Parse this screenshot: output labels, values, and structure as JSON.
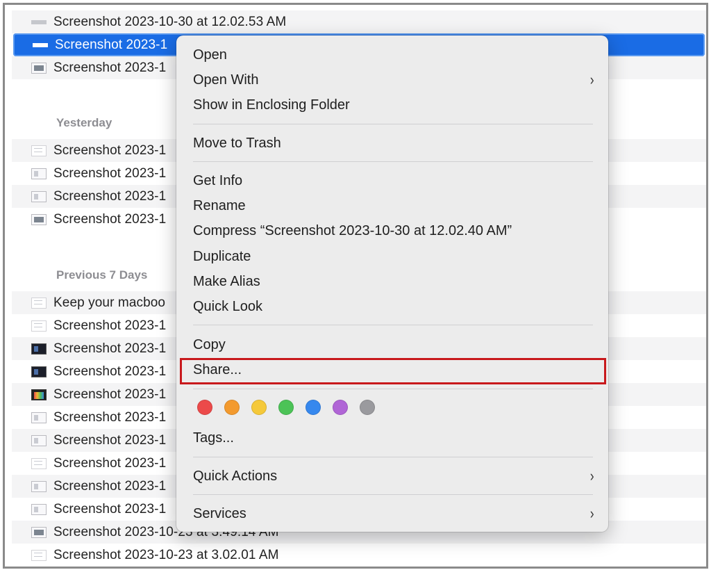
{
  "files": {
    "recent": [
      {
        "name": "Screenshot 2023-10-30 at 12.02.53 AM",
        "icon": "bar"
      },
      {
        "name": "Screenshot 2023-1",
        "icon": "bar",
        "selected": true
      },
      {
        "name": "Screenshot 2023-1",
        "icon": "photo"
      }
    ],
    "yesterday_header": "Yesterday",
    "yesterday": [
      {
        "name": "Screenshot 2023-1",
        "icon": "doc"
      },
      {
        "name": "Screenshot 2023-1",
        "icon": "plain"
      },
      {
        "name": "Screenshot 2023-1",
        "icon": "plain"
      },
      {
        "name": "Screenshot 2023-1",
        "icon": "photo"
      }
    ],
    "previous_header": "Previous 7 Days",
    "previous": [
      {
        "name": "Keep your macboo",
        "icon": "doc"
      },
      {
        "name": "Screenshot 2023-1",
        "icon": "doc"
      },
      {
        "name": "Screenshot 2023-1",
        "icon": "dark"
      },
      {
        "name": "Screenshot 2023-1",
        "icon": "dark"
      },
      {
        "name": "Screenshot 2023-1",
        "icon": "color"
      },
      {
        "name": "Screenshot 2023-1",
        "icon": "plain"
      },
      {
        "name": "Screenshot 2023-1",
        "icon": "plain"
      },
      {
        "name": "Screenshot 2023-1",
        "icon": "doc"
      },
      {
        "name": "Screenshot 2023-1",
        "icon": "plain"
      },
      {
        "name": "Screenshot 2023-1",
        "icon": "plain"
      },
      {
        "name": "Screenshot 2023-10-23 at 3.49.14 AM",
        "icon": "photo"
      },
      {
        "name": "Screenshot 2023-10-23 at 3.02.01 AM",
        "icon": "doc"
      }
    ]
  },
  "menu": {
    "open": "Open",
    "open_with": "Open With",
    "show_in_folder": "Show in Enclosing Folder",
    "move_to_trash": "Move to Trash",
    "get_info": "Get Info",
    "rename": "Rename",
    "compress": "Compress “Screenshot 2023-10-30 at 12.02.40 AM”",
    "duplicate": "Duplicate",
    "make_alias": "Make Alias",
    "quick_look": "Quick Look",
    "copy": "Copy",
    "share": "Share...",
    "tags": "Tags...",
    "quick_actions": "Quick Actions",
    "services": "Services",
    "submenu_glyph": "›"
  },
  "tag_colors": [
    {
      "name": "red",
      "color": "#ec4a4a"
    },
    {
      "name": "orange",
      "color": "#f39a2e"
    },
    {
      "name": "yellow",
      "color": "#f5c93a"
    },
    {
      "name": "green",
      "color": "#4cc357"
    },
    {
      "name": "blue",
      "color": "#3688ee"
    },
    {
      "name": "purple",
      "color": "#b065d6"
    },
    {
      "name": "gray",
      "color": "#9a9a9e"
    }
  ],
  "accent": {
    "selection": "#1a6ce5",
    "highlight_box": "#c8191c"
  }
}
